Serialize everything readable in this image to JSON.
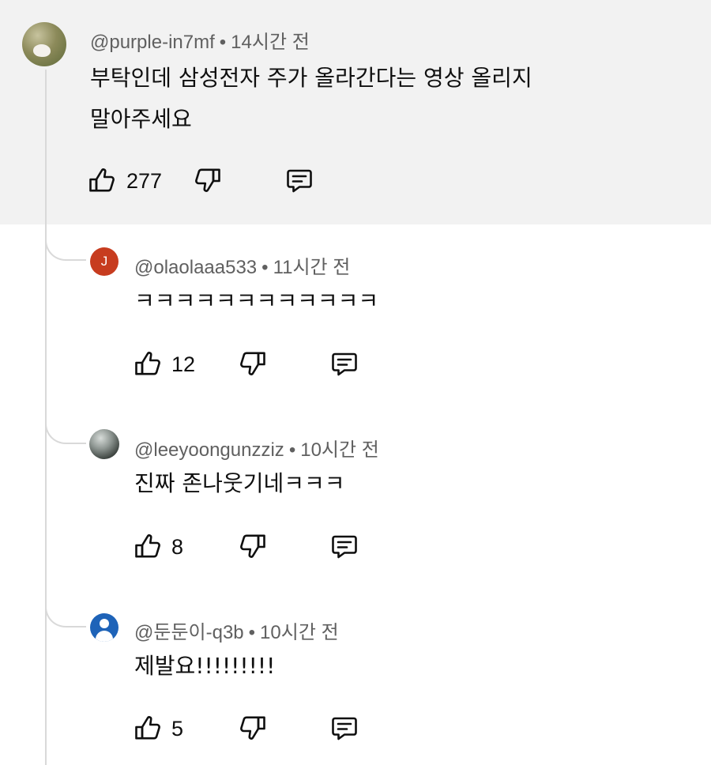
{
  "comments": [
    {
      "handle": "@purple-in7mf",
      "time": "14시간 전",
      "text_line1": "부탁인데 삼성전자 주가 올라간다는 영상 올리지",
      "text_line2": "말아주세요",
      "likes": "277"
    },
    {
      "avatar_letter": "J",
      "handle": "@olaolaaa533",
      "time": "11시간 전",
      "text": "ㅋㅋㅋㅋㅋㅋㅋㅋㅋㅋㅋㅋ",
      "likes": "12"
    },
    {
      "handle": "@leeyoongunzziz",
      "time": "10시간 전",
      "text": "진짜 존나웃기네ㅋㅋㅋ",
      "likes": "8"
    },
    {
      "handle": "@둔둔이-q3b",
      "time": "10시간 전",
      "text": "제발요!!!!!!!!!",
      "likes": "5"
    }
  ],
  "separator": "•",
  "icons": [
    "thumbs-up-icon",
    "thumbs-down-icon",
    "reply-icon"
  ],
  "colors": {
    "highlight_bg": "#f2f2f2",
    "meta_text": "#606060",
    "avatar_j": "#c73c1f",
    "avatar_user": "#1e63b8"
  }
}
